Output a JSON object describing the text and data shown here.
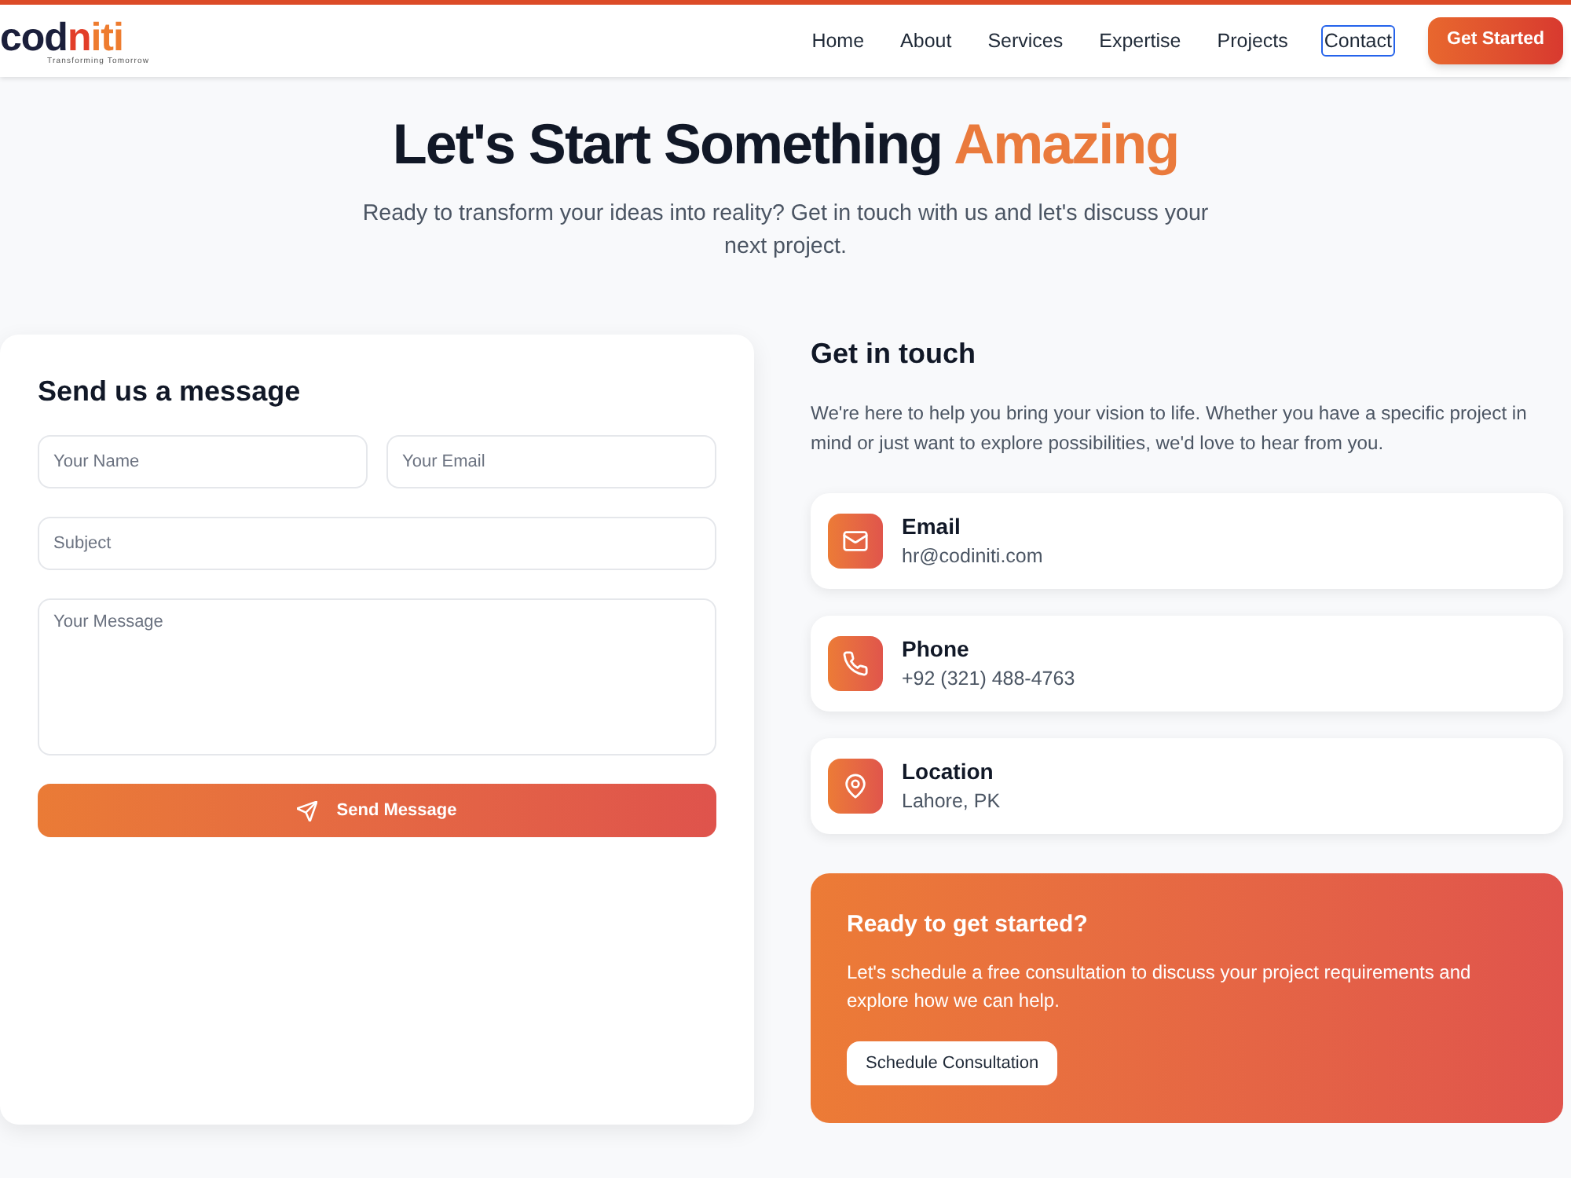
{
  "header": {
    "logo": {
      "parts": [
        {
          "text": "cod",
          "color": "#1b1f3b"
        },
        {
          "text": "n",
          "color": "#e23d28"
        },
        {
          "text": "iti",
          "color": "#ee7c2f"
        }
      ],
      "tagline": "Transforming Tomorrow"
    },
    "nav": [
      {
        "label": "Home",
        "focused": false
      },
      {
        "label": "About",
        "focused": false
      },
      {
        "label": "Services",
        "focused": false
      },
      {
        "label": "Expertise",
        "focused": false
      },
      {
        "label": "Projects",
        "focused": false
      },
      {
        "label": "Contact",
        "focused": true
      }
    ],
    "cta": "Get Started"
  },
  "hero": {
    "title": "Let's Start Something",
    "highlight": "Amazing",
    "subtitle": "Ready to transform your ideas into reality? Get in touch with us and let's discuss your next project."
  },
  "form": {
    "title": "Send us a message",
    "rows": [
      {
        "fields": [
          {
            "kind": "text",
            "placeholder": "Your Name"
          },
          {
            "kind": "text",
            "placeholder": "Your Email"
          }
        ]
      },
      {
        "fields": [
          {
            "kind": "text",
            "placeholder": "Subject"
          }
        ]
      },
      {
        "fields": [
          {
            "kind": "textarea",
            "placeholder": "Your Message"
          }
        ]
      }
    ],
    "submit": "Send Message"
  },
  "contact": {
    "title": "Get in touch",
    "text": "We're here to help you bring your vision to life. Whether you have a specific project in mind or just want to explore possibilities, we'd love to hear from you.",
    "items": [
      {
        "kind": "email",
        "label": "Email",
        "value": "hr@codiniti.com"
      },
      {
        "kind": "phone",
        "label": "Phone",
        "value": "+92 (321) 488-4763"
      },
      {
        "kind": "location",
        "label": "Location",
        "value": "Lahore, PK"
      }
    ]
  },
  "cta_panel": {
    "title": "Ready to get started?",
    "text": "Let's schedule a free consultation to discuss your project requirements and explore how we can help.",
    "button": "Schedule Consultation"
  }
}
